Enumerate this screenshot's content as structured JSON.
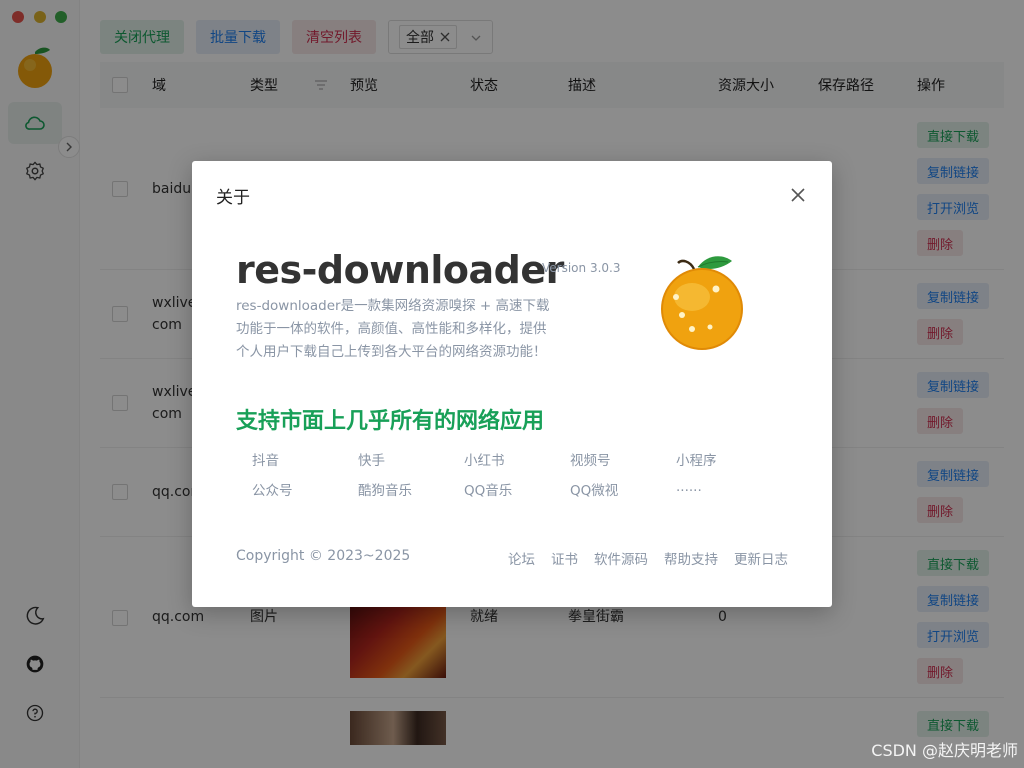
{
  "toolbar": {
    "close_proxy": "关闭代理",
    "batch_download": "批量下载",
    "clear_list": "清空列表",
    "filter_value": "全部"
  },
  "table": {
    "headers": [
      "域",
      "类型",
      "预览",
      "状态",
      "描述",
      "资源大小",
      "保存路径",
      "操作"
    ],
    "rows": [
      {
        "domain": "baidu.",
        "actions": [
          "直接下载",
          "复制链接",
          "打开浏览",
          "删除"
        ]
      },
      {
        "domain": "wxlive\ncom",
        "actions": [
          "复制链接",
          "删除"
        ]
      },
      {
        "domain": "wxlive\ncom",
        "actions": [
          "复制链接",
          "删除"
        ]
      },
      {
        "domain": "qq.cor",
        "actions": [
          "复制链接",
          "删除"
        ]
      },
      {
        "domain": "qq.com",
        "type": "图片",
        "status": "就绪",
        "desc": "拳皇街霸",
        "size": "0",
        "actions": [
          "直接下载",
          "复制链接",
          "打开浏览",
          "删除"
        ]
      },
      {
        "domain": "",
        "actions": [
          "直接下载"
        ]
      }
    ]
  },
  "modal": {
    "title": "关于",
    "app_name": "res-downloader",
    "version": "Version 3.0.3",
    "description": "res-downloader是一款集网络资源嗅探 + 高速下载功能于一体的软件，高颜值、高性能和多样化，提供个人用户下载自己上传到各大平台的网络资源功能！",
    "support_heading": "支持市面上几乎所有的网络应用",
    "apps": [
      "抖音",
      "快手",
      "小红书",
      "视频号",
      "小程序",
      "公众号",
      "酷狗音乐",
      "QQ音乐",
      "QQ微视",
      "......"
    ],
    "copyright": "Copyright © 2023~2025",
    "links": [
      "论坛",
      "证书",
      "软件源码",
      "帮助支持",
      "更新日志"
    ]
  },
  "watermark": "CSDN @赵庆明老师",
  "colors": {
    "accent_green": "#18a058",
    "accent_blue": "#2080f0",
    "accent_red": "#d03050",
    "muted_text": "#8a95a5"
  }
}
